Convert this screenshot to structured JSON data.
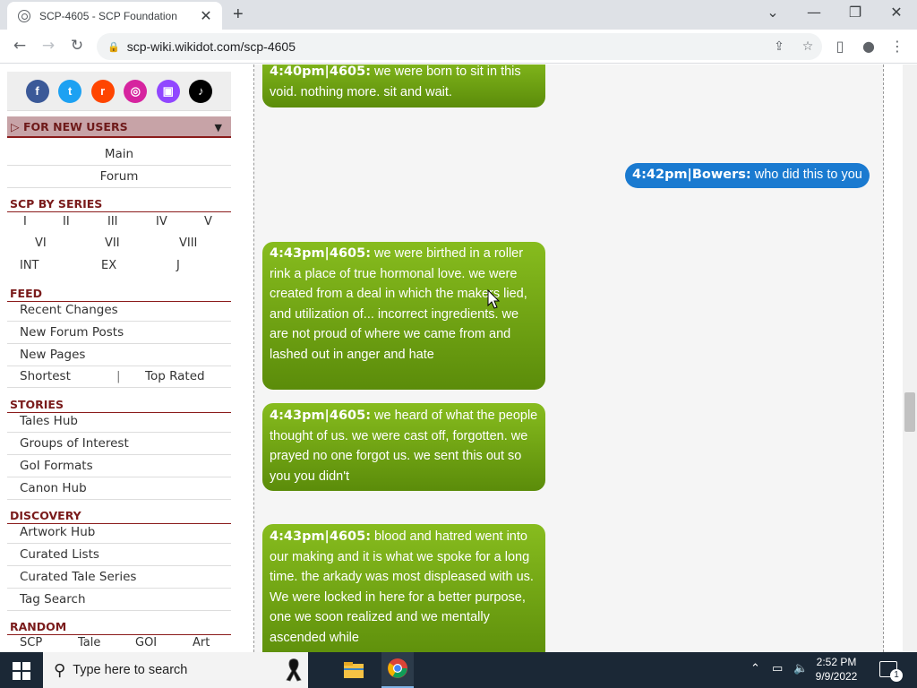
{
  "browser": {
    "tab_title": "SCP-4605 - SCP Foundation",
    "url": "scp-wiki.wikidot.com/scp-4605"
  },
  "sidebar": {
    "social": [
      "f",
      "t",
      "r",
      "i",
      "tw",
      "tk"
    ],
    "new_users": "FOR NEW USERS",
    "top_links": [
      "Main",
      "Forum"
    ],
    "scp_by_series": "SCP BY SERIES",
    "series_row1": [
      "I",
      "II",
      "III",
      "IV",
      "V"
    ],
    "series_row2": [
      "VI",
      "VII",
      "VIII"
    ],
    "series_row3": [
      "INT",
      "EX",
      "J"
    ],
    "feed": "FEED",
    "feed_items": [
      "Recent Changes",
      "New Forum Posts",
      "New Pages"
    ],
    "shortest": "Shortest",
    "sep": "|",
    "top_rated": "Top Rated",
    "stories": "STORIES",
    "stories_items": [
      "Tales Hub",
      "Groups of Interest",
      "GoI Formats",
      "Canon Hub"
    ],
    "discovery": "DISCOVERY",
    "discovery_items": [
      "Artwork Hub",
      "Curated Lists",
      "Curated Tale Series",
      "Tag Search"
    ],
    "random": "RANDOM",
    "random_items": [
      "SCP",
      "Tale",
      "GOI",
      "Art"
    ]
  },
  "chat": [
    {
      "who": "4:40pm|4605:",
      "text": "we were born to sit in this void. nothing more. sit and wait."
    },
    {
      "who": "4:42pm|Bowers:",
      "text": "who did this to you"
    },
    {
      "who": "4:43pm|4605:",
      "text": "we were birthed in a roller rink a place of true hormonal love. we were created from a deal in which the makers lied, and utilization of... incorrect ingredients. we are not proud of where we came from and lashed out in anger and hate"
    },
    {
      "who": "4:43pm|4605:",
      "text": "we heard of what the people thought of us. we were cast off, forgotten. we prayed no one forgot us. we sent this out so you you didn't"
    },
    {
      "who": "4:43pm|4605:",
      "text": "blood and hatred went into our making and it is what we spoke for a long time. the arkady was most displeased with us. We were locked in here for a better purpose, one we soon realized and we mentally ascended while"
    }
  ],
  "taskbar": {
    "search_placeholder": "Type here to search",
    "time": "2:52 PM",
    "date": "9/9/2022",
    "notif_count": "1"
  },
  "colors": {
    "green_bubble": "#6fa314",
    "blue_bubble": "#1a7ad0",
    "section": "#7a1b1b"
  }
}
